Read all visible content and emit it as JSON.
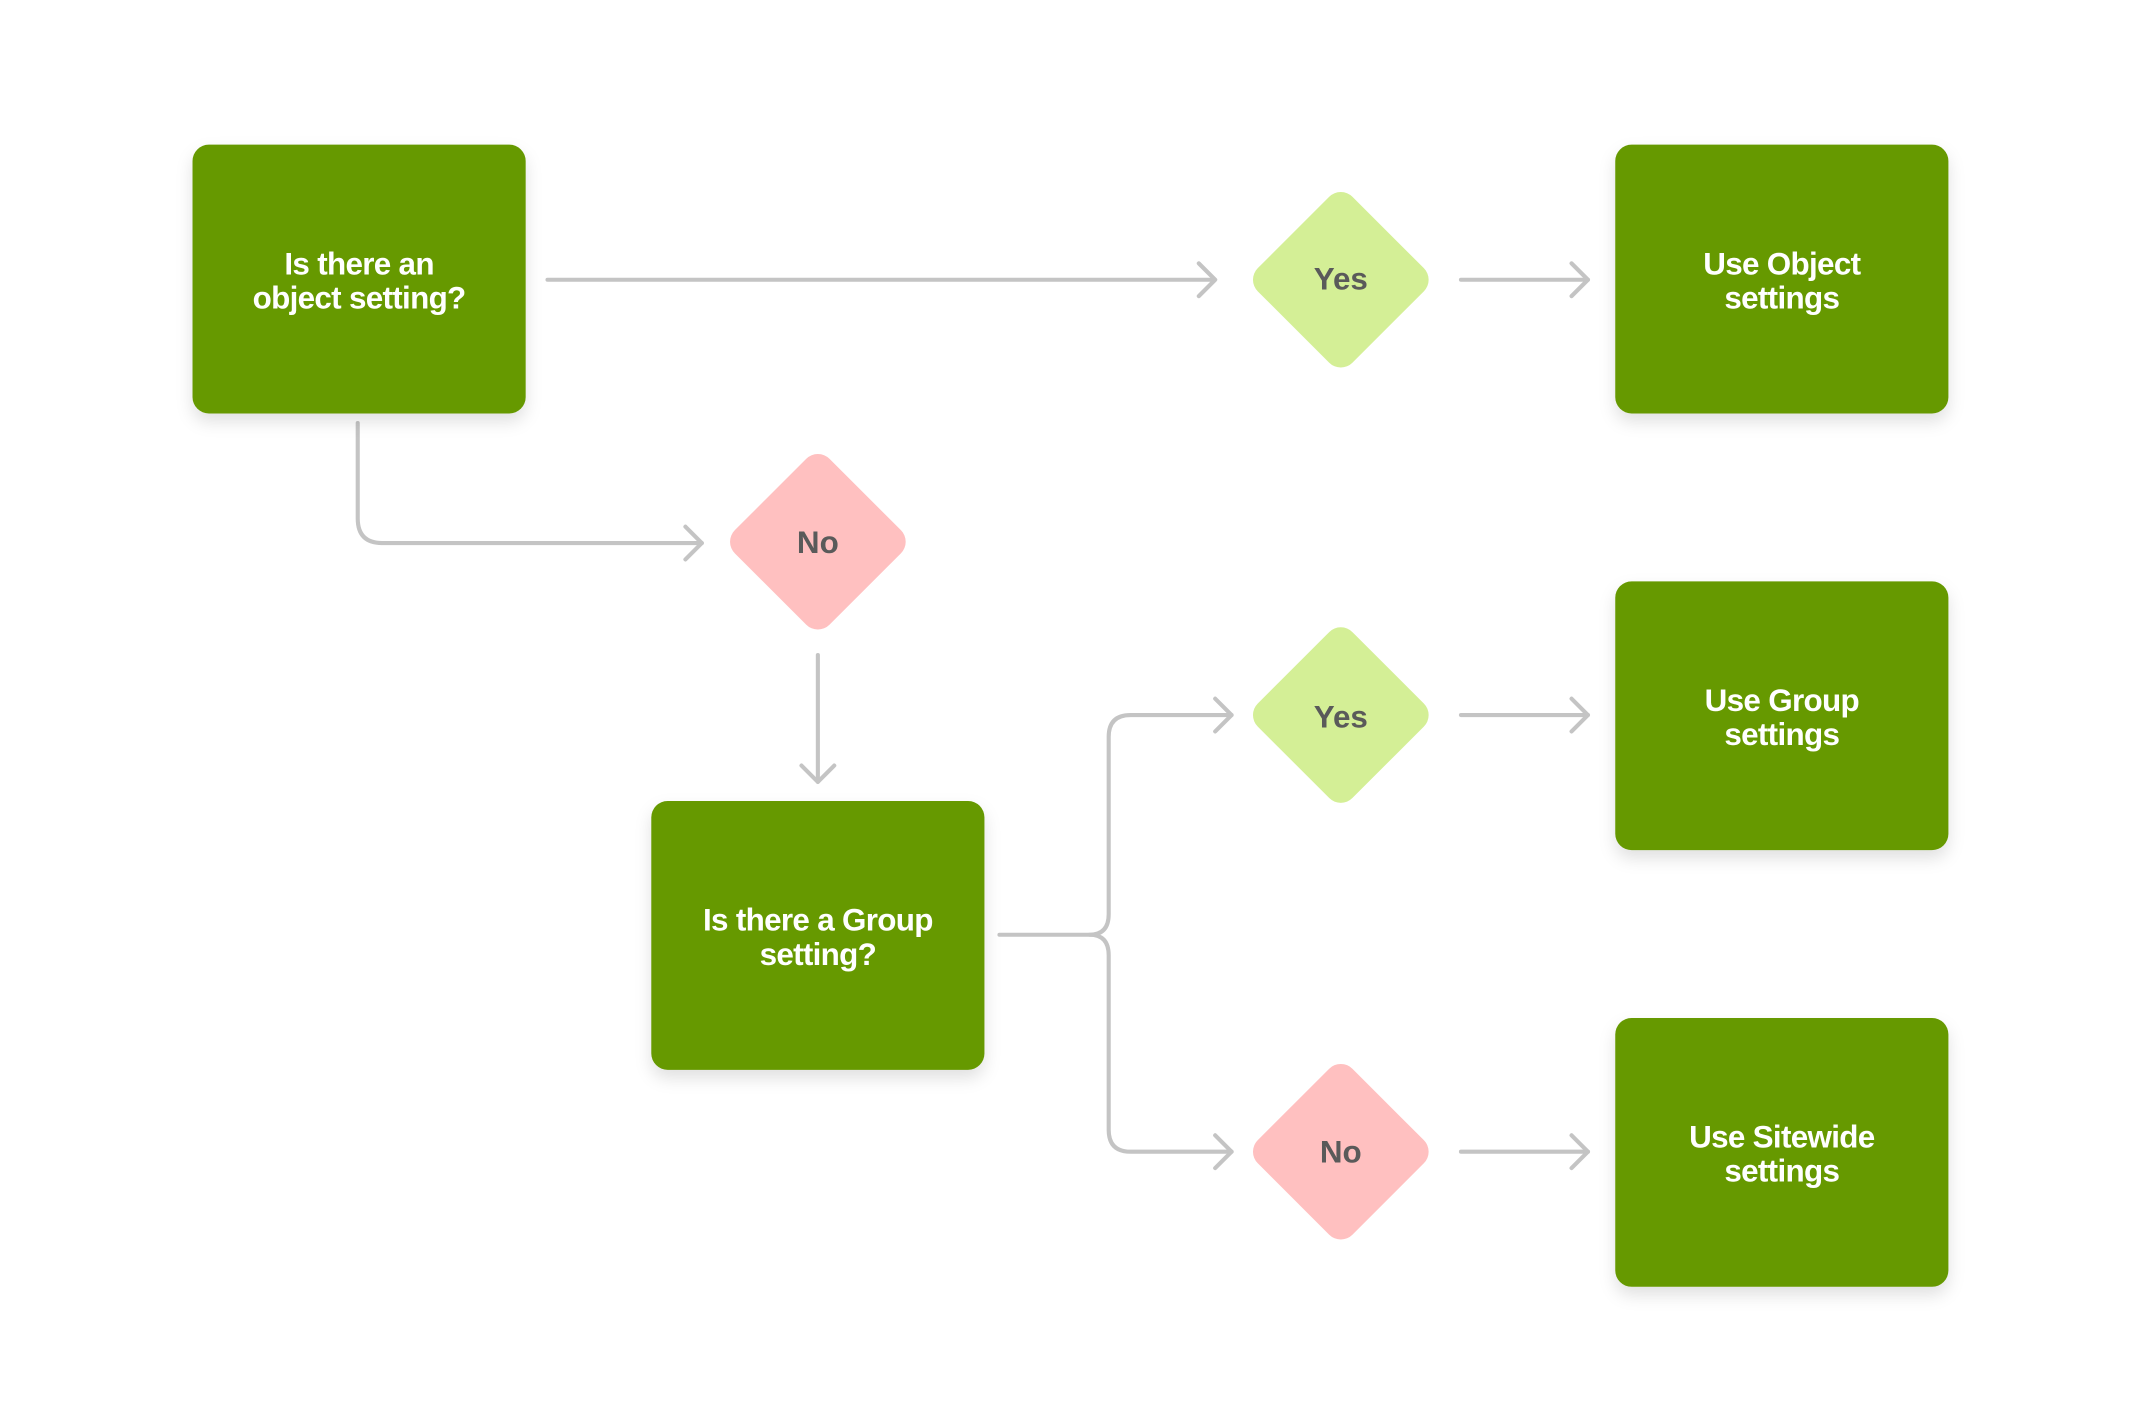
{
  "colors": {
    "process_box": "#669900",
    "yes_decision": "#d4ef96",
    "no_decision": "#ffc0c0",
    "connector": "#c4c4c4",
    "box_text": "#ffffff",
    "decision_text": "#5a5a5a"
  },
  "nodes": {
    "object_question": {
      "line1": "Is there an",
      "line2": "object setting?"
    },
    "use_object": {
      "line1": "Use Object",
      "line2": "settings"
    },
    "group_question": {
      "line1": "Is there a Group",
      "line2": "setting?"
    },
    "use_group": {
      "line1": "Use Group",
      "line2": "settings"
    },
    "use_sitewide": {
      "line1": "Use Sitewide",
      "line2": "settings"
    },
    "yes1": "Yes",
    "no1": "No",
    "yes2": "Yes",
    "no2": "No"
  }
}
